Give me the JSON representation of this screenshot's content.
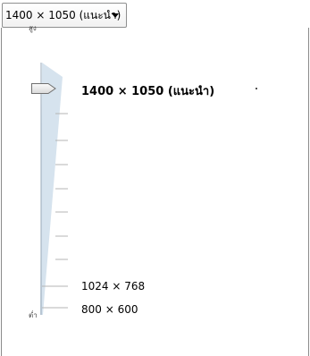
{
  "dropdown": {
    "value": "1400 × 1050 (แนะนำ)",
    "arrow_icon": "caret-down-icon"
  },
  "slider": {
    "high_label": "สูง",
    "low_label": "ต่ำ",
    "current_label": "1400 × 1050 (แนะนำ)",
    "options": [
      "1024 × 768",
      "800 × 600"
    ],
    "selected_index": 0,
    "track_color": "#d6e3ee",
    "tick_color": "#b4b4b4"
  }
}
